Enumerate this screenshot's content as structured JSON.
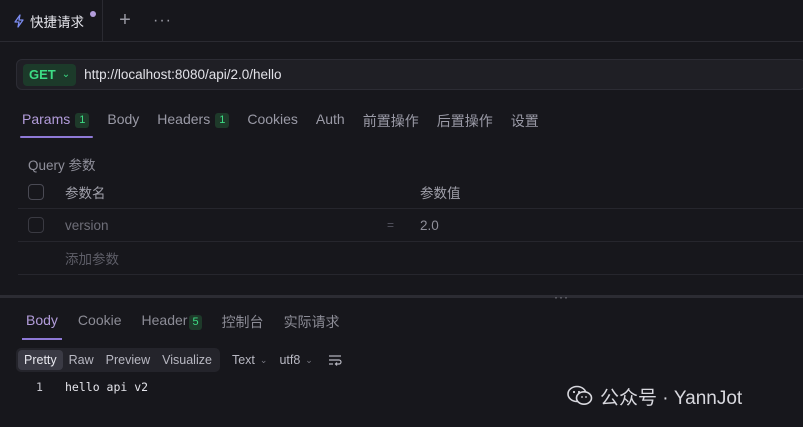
{
  "tabbar": {
    "tab_label": "快捷请求",
    "add_symbol": "+",
    "more_symbol": "···"
  },
  "request": {
    "method": "GET",
    "url": "http://localhost:8080/api/2.0/hello"
  },
  "request_tabs": [
    {
      "label": "Params",
      "badge": "1",
      "active": true
    },
    {
      "label": "Body"
    },
    {
      "label": "Headers",
      "badge": "1"
    },
    {
      "label": "Cookies"
    },
    {
      "label": "Auth"
    },
    {
      "label": "前置操作"
    },
    {
      "label": "后置操作"
    },
    {
      "label": "设置"
    }
  ],
  "query": {
    "section_label": "Query 参数",
    "col_name": "参数名",
    "col_value": "参数值",
    "rows": [
      {
        "name": "version",
        "eq": "=",
        "value": "2.0"
      }
    ],
    "add_label": "添加参数"
  },
  "splitter_dots": "···",
  "response_tabs": [
    {
      "label": "Body",
      "active": true
    },
    {
      "label": "Cookie"
    },
    {
      "label": "Header",
      "badge": "5"
    },
    {
      "label": "控制台"
    },
    {
      "label": "实际请求"
    }
  ],
  "format": {
    "options": [
      "Pretty",
      "Raw",
      "Preview",
      "Visualize"
    ],
    "selected": "Pretty",
    "type_value": "Text",
    "encoding_value": "utf8"
  },
  "code": {
    "line_number": "1",
    "line_text": "hello api v2"
  },
  "watermark": {
    "text": "公众号 · YannJot"
  },
  "colors": {
    "accent": "#8e79d6",
    "method_green": "#3ddc84",
    "background": "#17171c"
  }
}
